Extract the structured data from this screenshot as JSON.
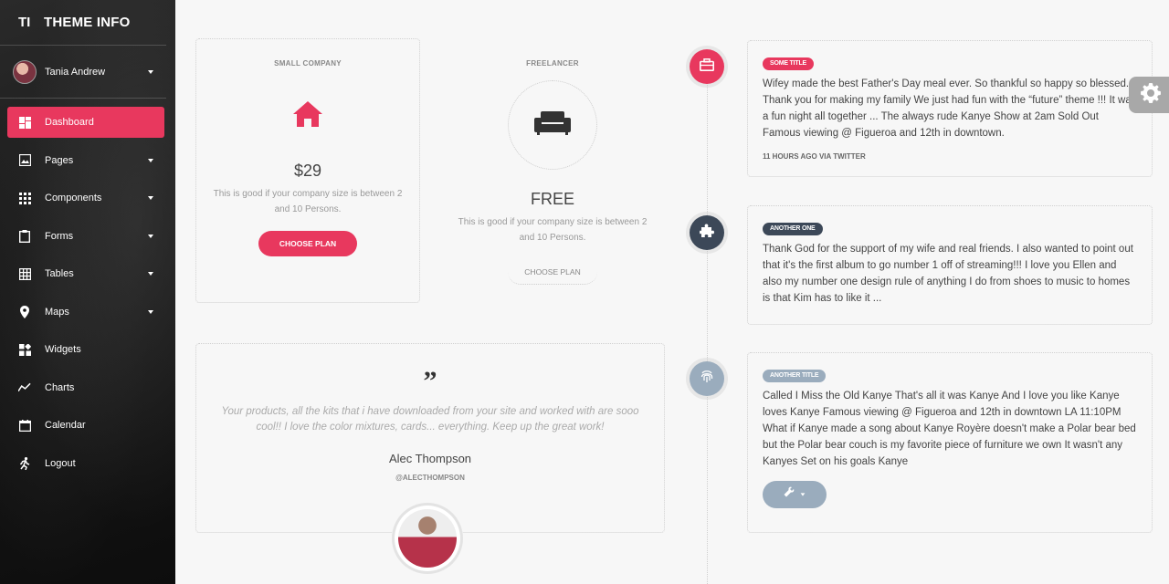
{
  "brand": {
    "mini": "TI",
    "full": "THEME INFO"
  },
  "user": {
    "name": "Tania Andrew"
  },
  "nav": [
    {
      "label": "Dashboard",
      "icon": "dashboard-icon",
      "active": true
    },
    {
      "label": "Pages",
      "icon": "image-icon",
      "caret": true
    },
    {
      "label": "Components",
      "icon": "apps-grid-icon",
      "caret": true
    },
    {
      "label": "Forms",
      "icon": "clipboard-icon",
      "caret": true
    },
    {
      "label": "Tables",
      "icon": "grid-icon",
      "caret": true
    },
    {
      "label": "Maps",
      "icon": "map-pin-icon",
      "caret": true
    },
    {
      "label": "Widgets",
      "icon": "widgets-icon"
    },
    {
      "label": "Charts",
      "icon": "line-chart-icon"
    },
    {
      "label": "Calendar",
      "icon": "calendar-icon"
    },
    {
      "label": "Logout",
      "icon": "running-person-icon"
    }
  ],
  "pricing": [
    {
      "category": "SMALL COMPANY",
      "icon": "home-icon",
      "price": "$29",
      "description": "This is good if your company size is between 2 and 10 Persons.",
      "button": "CHOOSE PLAN"
    },
    {
      "category": "FREELANCER",
      "icon": "sofa-icon",
      "price": "FREE",
      "description": "This is good if your company size is between 2 and 10 Persons.",
      "button": "CHOOSE PLAN"
    }
  ],
  "testimonial": {
    "quote_mark": "”",
    "text": "Your products, all the kits that i have downloaded from your site and worked with are sooo cool!! I love the color mixtures, cards... everything. Keep up the great work!",
    "author": "Alec Thompson",
    "handle": "@ALECTHOMPSON"
  },
  "timeline": [
    {
      "label": "SOME TITLE",
      "label_color": "#e8385e",
      "badge_color": "#e8385e",
      "badge_icon": "briefcase-icon",
      "paragraphs": [
        "Wifey made the best Father's Day meal ever. So thankful so happy so blessed. Thank you for making my family We just had fun with the “future” theme !!! It was a fun night all together ... The always rude Kanye Show at 2am Sold Out Famous viewing @ Figueroa and 12th in downtown."
      ],
      "footer": "11 HOURS AGO VIA TWITTER"
    },
    {
      "label": "ANOTHER ONE",
      "label_color": "#3c4858",
      "badge_color": "#3c4858",
      "badge_icon": "puzzle-icon",
      "paragraphs": [
        "Thank God for the support of my wife and real friends. I also wanted to point out that it's the first album to go number 1 off of streaming!!! I love you Ellen and also my number one design rule of anything I do from shoes to music to homes is that Kim has to like it ..."
      ]
    },
    {
      "label": "ANOTHER TITLE",
      "label_color": "#9aacbd",
      "badge_color": "#9aacbd",
      "badge_icon": "fingerprint-icon",
      "paragraphs": [
        "Called I Miss the Old Kanye That's all it was Kanye And I love you like Kanye loves Kanye Famous viewing @ Figueroa and 12th in downtown LA 11:10PM",
        "What if Kanye made a song about Kanye Royère doesn't make a Polar bear bed but the Polar bear couch is my favorite piece of furniture we own It wasn't any Kanyes Set on his goals Kanye"
      ],
      "tool_button": "wrench-icon"
    }
  ]
}
